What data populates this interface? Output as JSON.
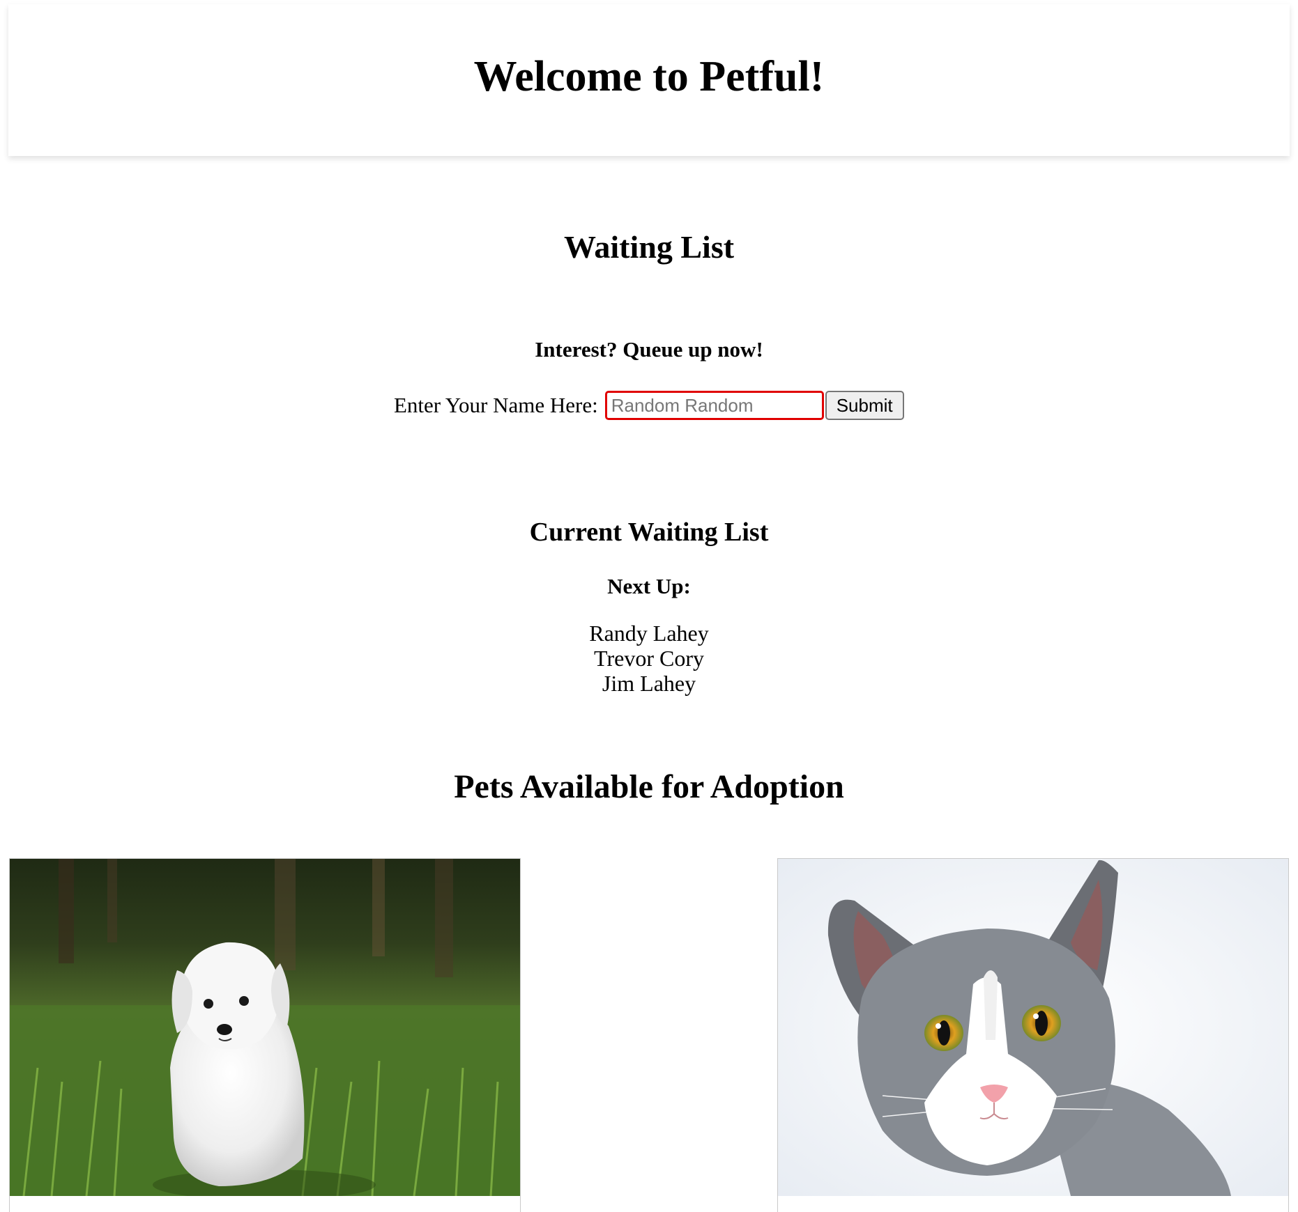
{
  "header": {
    "title": "Welcome to Petful!"
  },
  "waiting_list": {
    "title": "Waiting List",
    "queue_heading": "Interest? Queue up now!",
    "form": {
      "label": "Enter Your Name Here:",
      "input_placeholder": "Random Random",
      "input_value": "",
      "submit_label": "Submit"
    },
    "current_title": "Current Waiting List",
    "next_up_label": "Next Up:",
    "queue": [
      "Randy Lahey",
      "Trevor Cory",
      "Jim Lahey"
    ]
  },
  "pets": {
    "title": "Pets Available for Adoption",
    "cards": [
      {
        "type": "dog",
        "image_icon": "white-puppy-photo"
      },
      {
        "type": "cat",
        "image_icon": "gray-white-cat-photo"
      }
    ]
  },
  "colors": {
    "input_border": "#e00000",
    "header_shadow": "rgba(0,0,0,0.12)"
  }
}
